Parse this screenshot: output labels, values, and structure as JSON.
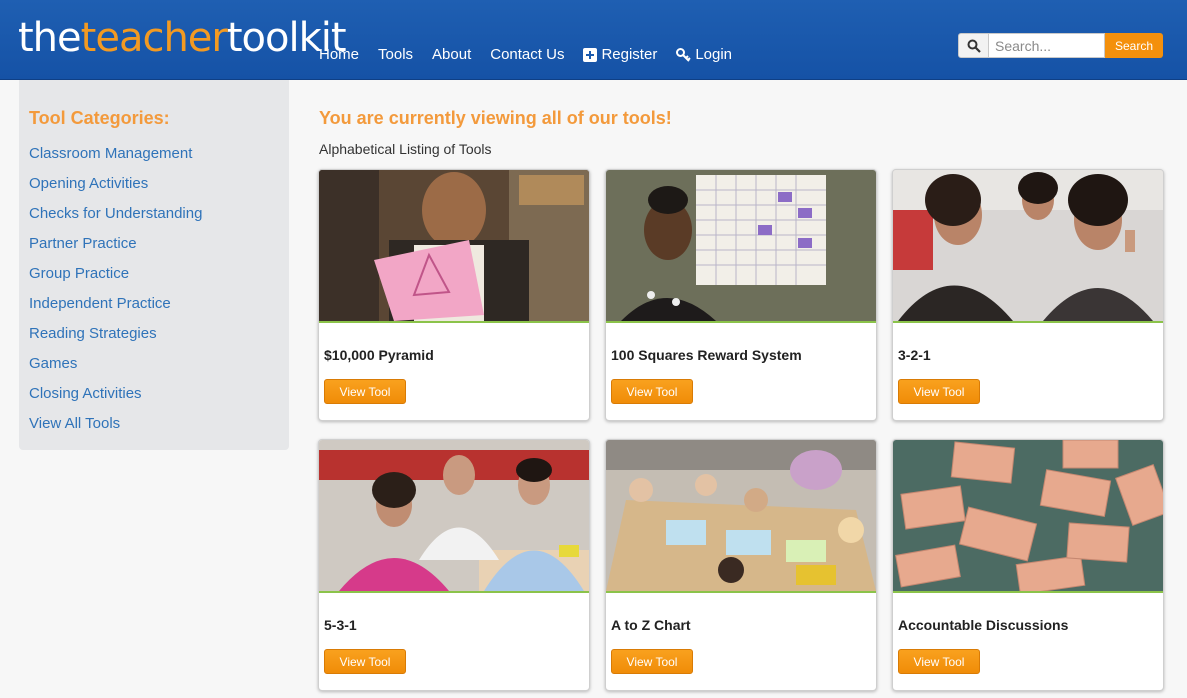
{
  "header": {
    "logo_part1": "the",
    "logo_part2": "teacher",
    "logo_part3": "toolkit",
    "nav": [
      {
        "label": "Home"
      },
      {
        "label": "Tools"
      },
      {
        "label": "About"
      },
      {
        "label": "Contact Us"
      },
      {
        "label": "Register",
        "icon": "plus-square-icon"
      },
      {
        "label": "Login",
        "icon": "key-icon"
      }
    ],
    "search": {
      "placeholder": "Search...",
      "button": "Search",
      "icon": "search-icon"
    }
  },
  "sidebar": {
    "title": "Tool Categories:",
    "items": [
      {
        "label": "Classroom Management"
      },
      {
        "label": "Opening Activities"
      },
      {
        "label": "Checks for Understanding"
      },
      {
        "label": "Partner Practice"
      },
      {
        "label": "Group Practice"
      },
      {
        "label": "Independent Practice"
      },
      {
        "label": "Reading Strategies"
      },
      {
        "label": "Games"
      },
      {
        "label": "Closing Activities"
      },
      {
        "label": "View All Tools"
      }
    ]
  },
  "main": {
    "title": "You are currently viewing all of our tools!",
    "subtitle": "Alphabetical Listing of Tools",
    "tools": [
      {
        "name": "$10,000 Pyramid",
        "button": "View Tool"
      },
      {
        "name": "100 Squares Reward System",
        "button": "View Tool"
      },
      {
        "name": "3-2-1",
        "button": "View Tool"
      },
      {
        "name": "5-3-1",
        "button": "View Tool"
      },
      {
        "name": "A to Z Chart",
        "button": "View Tool"
      },
      {
        "name": "Accountable Discussions",
        "button": "View Tool"
      }
    ]
  },
  "colors": {
    "header_blue": "#1a5aae",
    "accent_orange": "#f4900c",
    "link_blue": "#2f73b9",
    "heading_orange": "#f39a3c",
    "divider_green": "#8bc34a"
  }
}
